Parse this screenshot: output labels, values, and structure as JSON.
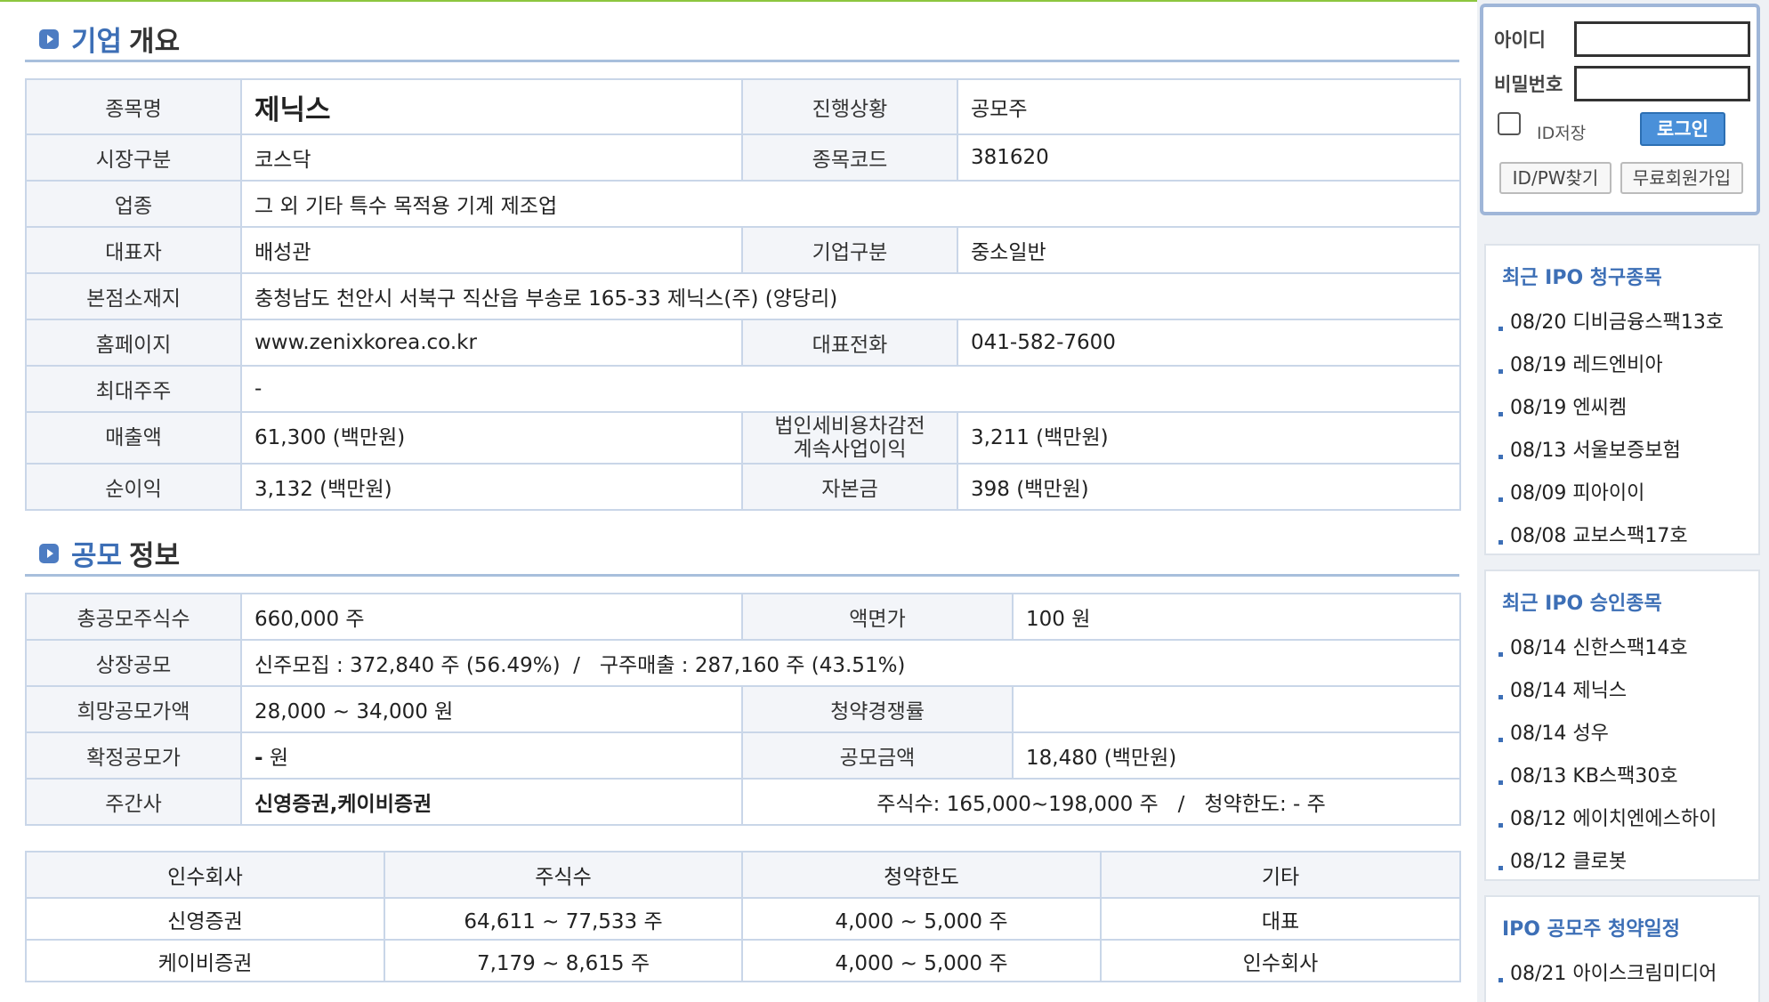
{
  "company": {
    "title_blue": "기업",
    "title_dark": "개요",
    "rows": {
      "name_label": "종목명",
      "name_value": "제닉스",
      "status_label": "진행상황",
      "status_value": "공모주",
      "market_label": "시장구분",
      "market_value": "코스닥",
      "code_label": "종목코드",
      "code_value": "381620",
      "industry_label": "업종",
      "industry_value": "그 외 기타 특수 목적용 기계 제조업",
      "ceo_label": "대표자",
      "ceo_value": "배성관",
      "type_label": "기업구분",
      "type_value": "중소일반",
      "address_label": "본점소재지",
      "address_value": "충청남도 천안시 서북구 직산읍 부송로 165-33 제닉스(주) (양당리)",
      "homepage_label": "홈페이지",
      "homepage_value": "www.zenixkorea.co.kr",
      "phone_label": "대표전화",
      "phone_value": "041-582-7600",
      "shareholder_label": "최대주주",
      "shareholder_value": "-",
      "sales_label": "매출액",
      "sales_value": "61,300 (백만원)",
      "pretax_label_1": "법인세비용차감전",
      "pretax_label_2": "계속사업이익",
      "pretax_value": "3,211 (백만원)",
      "net_label": "순이익",
      "net_value": "3,132 (백만원)",
      "capital_label": "자본금",
      "capital_value": "398 (백만원)"
    }
  },
  "offering": {
    "title_blue": "공모",
    "title_dark": "정보",
    "rows": {
      "total_label": "총공모주식수",
      "total_value": "660,000 주",
      "par_label": "액면가",
      "par_value": "100 원",
      "listing_label": "상장공모",
      "listing_value": "신주모집 : 372,840 주 (56.49%)  /   구주매출 : 287,160 주 (43.51%)",
      "hope_label": "희망공모가액",
      "hope_value": "28,000 ~ 34,000 원",
      "competition_label": "청약경쟁률",
      "competition_value": "",
      "confirmed_label": "확정공모가",
      "confirmed_dash": "-",
      "confirmed_unit": " 원",
      "amount_label": "공모금액",
      "amount_value": "18,480 (백만원)",
      "manager_label": "주간사",
      "manager_value": "신영증권,케이비증권",
      "manager_detail": "주식수: 165,000~198,000 주   /   청약한도: - 주"
    }
  },
  "underwriters": {
    "headers": [
      "인수회사",
      "주식수",
      "청약한도",
      "기타"
    ],
    "rows": [
      [
        "신영증권",
        "64,611 ~ 77,533 주",
        "4,000 ~ 5,000 주",
        "대표"
      ],
      [
        "케이비증권",
        "7,179 ~ 8,615 주",
        "4,000 ~ 5,000 주",
        "인수회사"
      ]
    ]
  },
  "login": {
    "id_label": "아이디",
    "pw_label": "비밀번호",
    "remember_label": "ID저장",
    "login_button": "로그인",
    "find_button": "ID/PW찾기",
    "signup_button": "무료회원가입"
  },
  "sidebar": {
    "recent_claim": {
      "title": "최근 IPO 청구종목",
      "items": [
        "08/20 디비금융스팩13호",
        "08/19 레드엔비아",
        "08/19 엔씨켐",
        "08/13 서울보증보험",
        "08/09 피아이이",
        "08/08 교보스팩17호"
      ]
    },
    "recent_approved": {
      "title": "최근 IPO 승인종목",
      "items": [
        "08/14 신한스팩14호",
        "08/14 제닉스",
        "08/14 성우",
        "08/13 KB스팩30호",
        "08/12 에이치엔에스하이",
        "08/12 클로봇"
      ]
    },
    "schedule": {
      "title": "IPO 공모주 청약일정",
      "items": [
        "08/21 아이스크림미디어"
      ]
    }
  }
}
